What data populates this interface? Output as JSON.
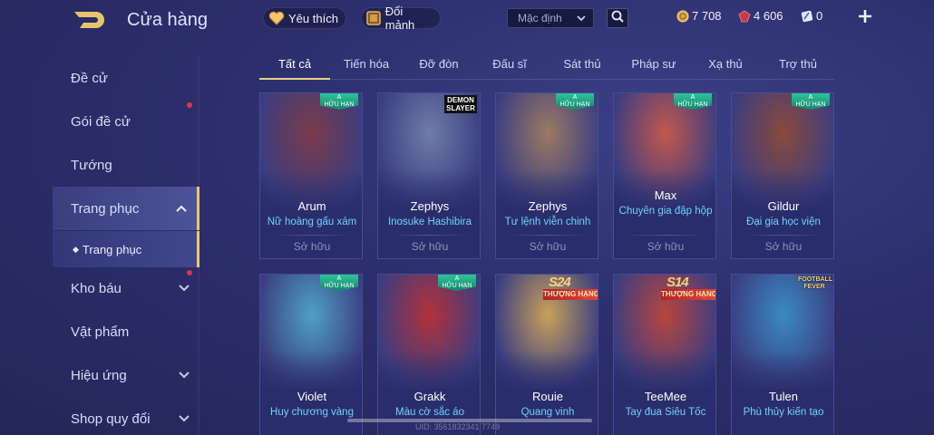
{
  "header": {
    "title": "Cửa hàng",
    "favorite_label": "Yêu thích",
    "shard_label": "Đổi mảnh",
    "sort_value": "Mặc định"
  },
  "currency": {
    "gold": "7 708",
    "ruby": "4 606",
    "ticket": "0"
  },
  "sidebar": {
    "items": [
      {
        "label": "Đề cử"
      },
      {
        "label": "Gói đề cử"
      },
      {
        "label": "Tướng"
      },
      {
        "label": "Trang phục"
      },
      {
        "label": "Kho báu"
      },
      {
        "label": "Vật phẩm"
      },
      {
        "label": "Hiệu ứng"
      },
      {
        "label": "Shop quy đổi"
      }
    ],
    "sub_item": "Trang phục"
  },
  "tabs": [
    "Tất cả",
    "Tiến hóa",
    "Đỡ đòn",
    "Đấu sĩ",
    "Sát thủ",
    "Pháp sư",
    "Xạ thủ",
    "Trợ thủ"
  ],
  "owned_label": "Sở hữu",
  "badges": {
    "a_line1": "A",
    "a_line2": "HỮU HẠN",
    "s24": "S24",
    "s14": "S14",
    "rank_label": "THƯỢNG HẠNG",
    "demon_slayer": "DEMON SLAYER",
    "football": "FOOTBALL FEVER"
  },
  "cards": [
    {
      "hero": "Arum",
      "skin": "Nữ hoàng gấu xám",
      "art": "#7a3b4a"
    },
    {
      "hero": "Zephys",
      "skin": "Inosuke Hashibira",
      "art": "#6f7da8"
    },
    {
      "hero": "Zephys",
      "skin": "Tư lệnh viễn chinh",
      "art": "#9a7a62"
    },
    {
      "hero": "Max",
      "skin": "Chuyên gia đập hộp",
      "art": "#c2584c"
    },
    {
      "hero": "Gildur",
      "skin": "Đại gia học viện",
      "art": "#8a4a3c"
    },
    {
      "hero": "Violet",
      "skin": "Huy chương vàng",
      "art": "#4fa0c8"
    },
    {
      "hero": "Grakk",
      "skin": "Màu cờ sắc áo",
      "art": "#b2323a"
    },
    {
      "hero": "Rouie",
      "skin": "Quang vinh",
      "art": "#c7a15a"
    },
    {
      "hero": "TeeMee",
      "skin": "Tay đua Siêu Tốc",
      "art": "#b8463e"
    },
    {
      "hero": "Tulen",
      "skin": "Phù thủy kiến tạo",
      "art": "#3a8ac2"
    }
  ],
  "uid_text": "UID: 3561832341 7749"
}
